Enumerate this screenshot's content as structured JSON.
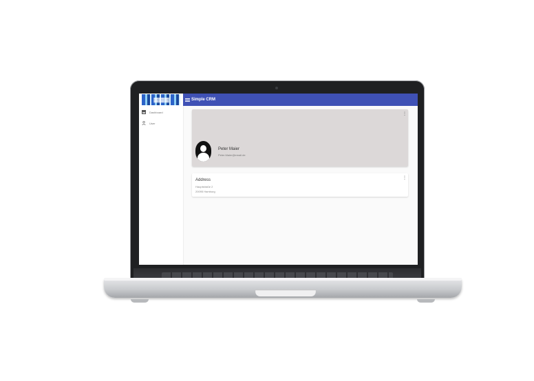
{
  "app": {
    "title": "Simple CRM",
    "brand_color": "#3f51b5"
  },
  "sidebar": {
    "items": [
      {
        "label": "Dashboard",
        "icon": "dashboard-icon"
      },
      {
        "label": "User",
        "icon": "person-icon"
      }
    ]
  },
  "profile": {
    "name": "Peter Maier",
    "email": "Peter.Maier@email.de",
    "card_color": "#dcd8d8"
  },
  "address": {
    "title": "Address",
    "street": "Hauptstraße 2",
    "city": "20095 Hamburg"
  },
  "icons": {
    "more": "more-vert-icon",
    "menu": "menu-icon",
    "avatar": "avatar-icon"
  }
}
